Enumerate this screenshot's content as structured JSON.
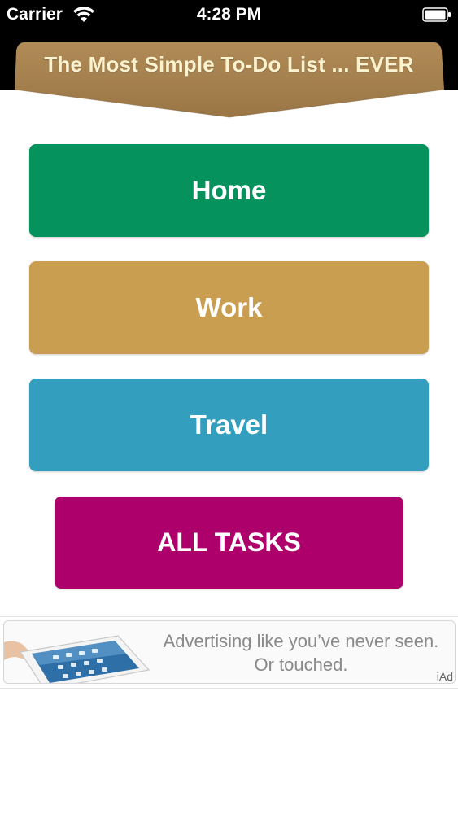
{
  "status_bar": {
    "carrier": "Carrier",
    "time": "4:28 PM",
    "wifi_icon": "wifi-icon",
    "battery_icon": "battery-icon"
  },
  "header": {
    "title": "The Most Simple To-Do List ... EVER",
    "banner_color": "#a3804c"
  },
  "categories": [
    {
      "label": "Home",
      "color": "#05925c"
    },
    {
      "label": "Work",
      "color": "#c99e50"
    },
    {
      "label": "Travel",
      "color": "#339ebd"
    }
  ],
  "all_tasks": {
    "label": "ALL TASKS",
    "color": "#ad006b"
  },
  "ad": {
    "line1": "Advertising like you’ve never seen.",
    "line2": "Or touched.",
    "mark": "iAd",
    "image_icon": "ipad-icon"
  }
}
